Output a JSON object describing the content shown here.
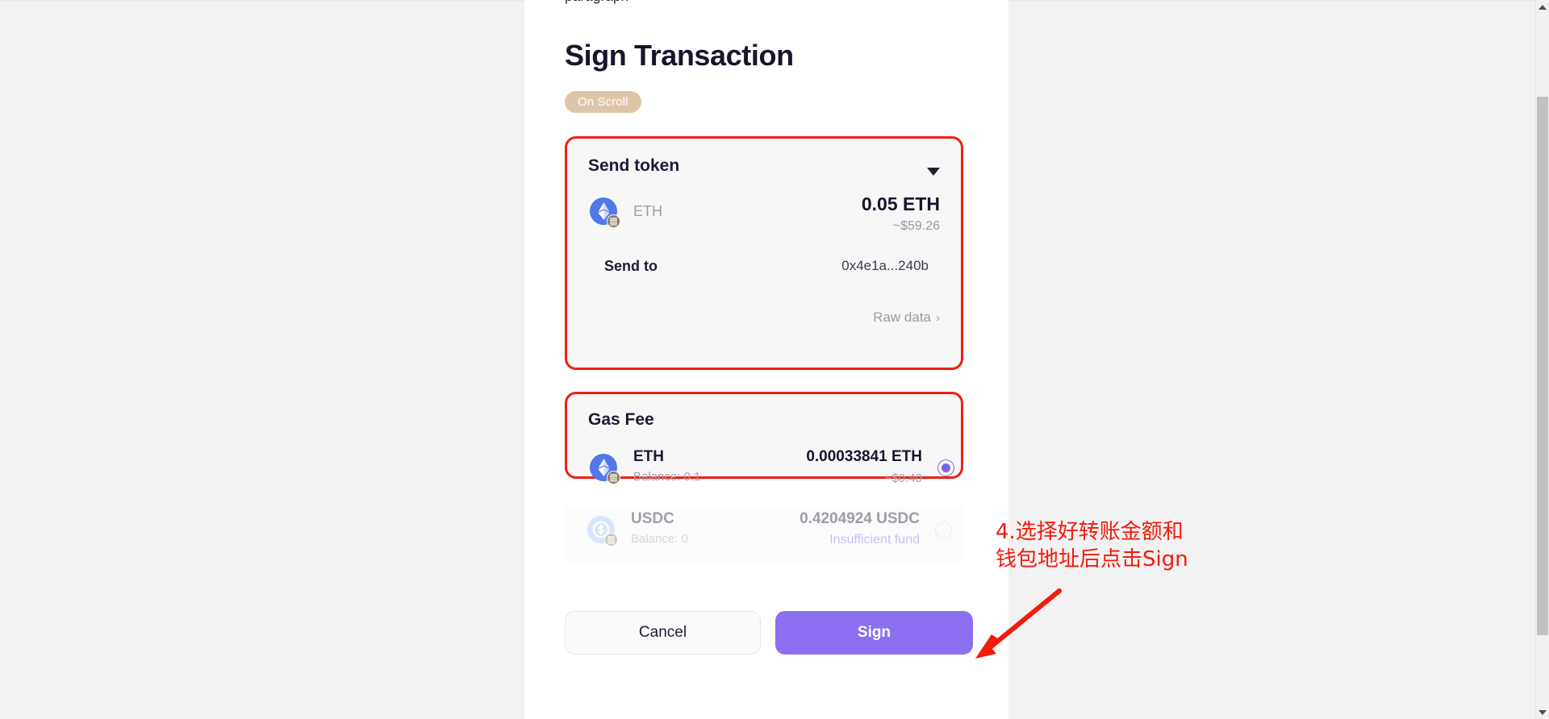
{
  "page": {
    "background_color": "#f2f2f2",
    "clipped_top_text": "paragraph",
    "title": "Sign Transaction",
    "network_badge": "On Scroll",
    "accent_purple": "#8b6ff0",
    "highlight_red": "#f01f12",
    "badge_bg": "#ddc5a7"
  },
  "send_token_card": {
    "title": "Send token",
    "chevron_icon": "chevron-down-icon",
    "token": {
      "icon": "eth-token-icon",
      "network_badge_icon": "scroll-network-icon",
      "symbol": "ETH",
      "amount": "0.05 ETH",
      "fiat": "~$59.26"
    },
    "send_to": {
      "label": "Send to",
      "address": "0x4e1a...240b"
    },
    "raw_data": {
      "label": "Raw data",
      "arrow_icon": "chevron-right-icon",
      "arrow": "›"
    }
  },
  "gas_fee_card": {
    "title": "Gas Fee",
    "options": [
      {
        "icon": "eth-token-icon",
        "network_badge_icon": "scroll-network-icon",
        "name": "ETH",
        "balance": "Balance:  0.1",
        "amount": "0.00033841 ETH",
        "fiat": "~$0.40",
        "selected": true,
        "disabled": false
      },
      {
        "icon": "usdc-token-icon",
        "network_badge_icon": "scroll-network-icon",
        "name": "USDC",
        "balance": "Balance:  0",
        "amount": "0.4204924 USDC",
        "note": "Insufficient fund",
        "note_color": "#7b60ef",
        "selected": false,
        "disabled": true
      }
    ]
  },
  "actions": {
    "cancel_label": "Cancel",
    "sign_label": "Sign"
  },
  "annotation": {
    "text": "4.选择好转账金额和\n钱包地址后点击Sign",
    "color": "#f41a0c",
    "arrow_icon": "red-arrow-icon"
  },
  "scrollbar": {
    "up_icon": "scroll-up-arrow-icon",
    "down_icon": "scroll-down-arrow-icon",
    "thumb": "scrollbar-thumb"
  }
}
